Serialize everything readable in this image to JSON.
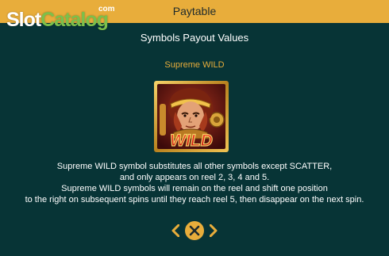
{
  "header": {
    "title": "Paytable"
  },
  "logo": {
    "part1": "Slot",
    "part2": "Catalog",
    "suffix": "com"
  },
  "page": {
    "section_title": "Symbols Payout Values",
    "symbol_name": "Supreme WILD",
    "symbol_icon": "monkey-king-wild-icon",
    "symbol_text": "WILD",
    "description": [
      "Supreme WILD symbol substitutes all other symbols except SCATTER,",
      "and only appears on reel 2, 3, 4 and 5.",
      "Supreme WILD symbols will remain on the reel and shift one position",
      "to the right on subsequent spins until they reach reel 5, then disappear on the next spin."
    ]
  },
  "nav": {
    "prev_icon": "chevron-left-icon",
    "close_icon": "close-icon",
    "next_icon": "chevron-right-icon"
  },
  "colors": {
    "background": "#073436",
    "header": "#e8ad3b",
    "accent": "#e8ad3b",
    "wild_text": "#e0201c"
  }
}
